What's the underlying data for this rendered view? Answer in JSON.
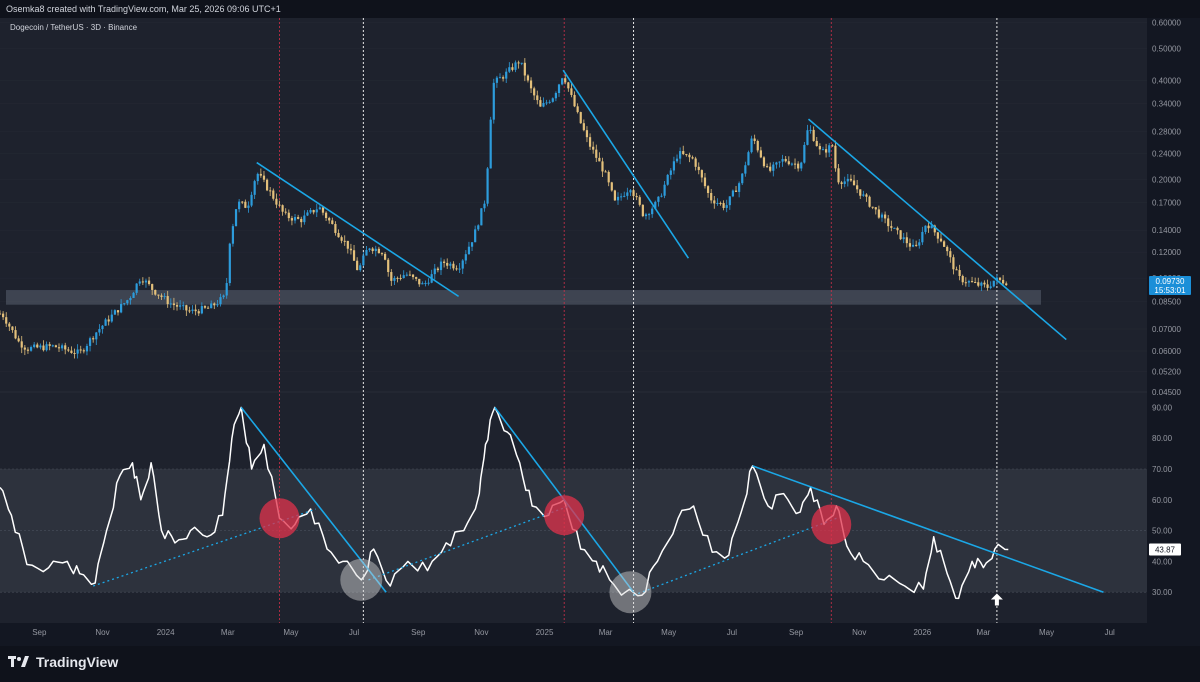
{
  "header": {
    "attribution": "Osemka8 created with TradingView.com, Mar 25, 2026 09:06 UTC+1",
    "symbol": "Dogecoin / TetherUS · 3D · Binance"
  },
  "price_badge": {
    "price": "0.09730",
    "countdown": "15:53:01"
  },
  "rsi_badge": "43.87",
  "footer": {
    "brand": "TradingView"
  },
  "colors": {
    "background": "#131722",
    "up": "#2d9cdb",
    "down": "#e3c07b",
    "trendline": "#1ba7e6",
    "rsi_line": "#ffffff",
    "zone": "#5a6170",
    "red_marker": "#e0314b",
    "price_badge": "#1b8fd8"
  },
  "chart_data": [
    {
      "type": "candlestick",
      "title": "Dogecoin / TetherUS · 3D · Binance",
      "scale": "log",
      "y_ticks": [
        "0.60000",
        "0.50000",
        "0.40000",
        "0.34000",
        "0.28000",
        "0.24000",
        "0.20000",
        "0.17000",
        "0.14000",
        "0.12000",
        "0.10000",
        "0.08500",
        "0.07000",
        "0.06000",
        "0.05200",
        "0.04500"
      ],
      "x_ticks": [
        "Sep",
        "Nov",
        "2024",
        "Mar",
        "May",
        "Jul",
        "Sep",
        "Nov",
        "2025",
        "Mar",
        "May",
        "Jul",
        "Sep",
        "Nov",
        "2026",
        "Mar",
        "May",
        "Jul"
      ],
      "xlim": [
        "2023-07-25",
        "2026-08-06"
      ],
      "ylim": [
        0.045,
        0.62
      ],
      "close_series": [
        [
          "2023-07-27",
          0.078
        ],
        [
          "2023-08-12",
          0.064
        ],
        [
          "2023-08-20",
          0.061
        ],
        [
          "2023-09-15",
          0.062
        ],
        [
          "2023-10-10",
          0.059
        ],
        [
          "2023-10-25",
          0.068
        ],
        [
          "2023-11-12",
          0.078
        ],
        [
          "2023-11-27",
          0.087
        ],
        [
          "2023-12-08",
          0.101
        ],
        [
          "2023-12-20",
          0.092
        ],
        [
          "2024-01-05",
          0.084
        ],
        [
          "2024-01-25",
          0.079
        ],
        [
          "2024-02-12",
          0.081
        ],
        [
          "2024-02-28",
          0.088
        ],
        [
          "2024-03-03",
          0.13
        ],
        [
          "2024-03-10",
          0.17
        ],
        [
          "2024-03-20",
          0.165
        ],
        [
          "2024-03-29",
          0.21
        ],
        [
          "2024-04-10",
          0.185
        ],
        [
          "2024-04-25",
          0.155
        ],
        [
          "2024-05-10",
          0.15
        ],
        [
          "2024-05-28",
          0.165
        ],
        [
          "2024-06-10",
          0.145
        ],
        [
          "2024-06-25",
          0.125
        ],
        [
          "2024-07-05",
          0.105
        ],
        [
          "2024-07-15",
          0.125
        ],
        [
          "2024-07-30",
          0.12
        ],
        [
          "2024-08-05",
          0.098
        ],
        [
          "2024-08-20",
          0.103
        ],
        [
          "2024-09-06",
          0.095
        ],
        [
          "2024-09-25",
          0.112
        ],
        [
          "2024-10-10",
          0.108
        ],
        [
          "2024-10-25",
          0.135
        ],
        [
          "2024-11-05",
          0.175
        ],
        [
          "2024-11-12",
          0.39
        ],
        [
          "2024-11-25",
          0.42
        ],
        [
          "2024-12-08",
          0.46
        ],
        [
          "2024-12-18",
          0.38
        ],
        [
          "2024-12-28",
          0.33
        ],
        [
          "2025-01-10",
          0.36
        ],
        [
          "2025-01-19",
          0.42
        ],
        [
          "2025-02-01",
          0.32
        ],
        [
          "2025-02-12",
          0.26
        ],
        [
          "2025-02-28",
          0.21
        ],
        [
          "2025-03-10",
          0.17
        ],
        [
          "2025-03-25",
          0.19
        ],
        [
          "2025-04-07",
          0.155
        ],
        [
          "2025-04-20",
          0.17
        ],
        [
          "2025-05-10",
          0.24
        ],
        [
          "2025-05-25",
          0.23
        ],
        [
          "2025-06-10",
          0.175
        ],
        [
          "2025-06-25",
          0.165
        ],
        [
          "2025-07-10",
          0.2
        ],
        [
          "2025-07-21",
          0.27
        ],
        [
          "2025-08-05",
          0.21
        ],
        [
          "2025-08-20",
          0.23
        ],
        [
          "2025-09-05",
          0.22
        ],
        [
          "2025-09-13",
          0.29
        ],
        [
          "2025-09-25",
          0.24
        ],
        [
          "2025-10-07",
          0.255
        ],
        [
          "2025-10-10",
          0.2
        ],
        [
          "2025-10-25",
          0.195
        ],
        [
          "2025-11-10",
          0.17
        ],
        [
          "2025-11-25",
          0.15
        ],
        [
          "2025-12-10",
          0.135
        ],
        [
          "2025-12-25",
          0.122
        ],
        [
          "2026-01-05",
          0.148
        ],
        [
          "2026-01-20",
          0.13
        ],
        [
          "2026-02-05",
          0.1
        ],
        [
          "2026-02-20",
          0.096
        ],
        [
          "2026-03-05",
          0.094
        ],
        [
          "2026-03-12",
          0.099
        ],
        [
          "2026-03-25",
          0.0973
        ]
      ],
      "support_zone": [
        0.083,
        0.092
      ],
      "trendlines": [
        [
          [
            "2024-03-29",
            0.225
          ],
          [
            "2024-10-10",
            0.088
          ]
        ],
        [
          [
            "2025-01-19",
            0.43
          ],
          [
            "2025-05-20",
            0.115
          ]
        ],
        [
          [
            "2025-09-13",
            0.305
          ],
          [
            "2026-05-20",
            0.065
          ]
        ]
      ]
    },
    {
      "type": "line",
      "y_ticks": [
        "90.00",
        "80.00",
        "70.00",
        "60.00",
        "50.00",
        "40.00",
        "30.00"
      ],
      "x_ticks": [
        "Sep",
        "Nov",
        "2024",
        "Mar",
        "May",
        "Jul",
        "Sep",
        "Nov",
        "2025",
        "Mar",
        "May",
        "Jul",
        "Sep",
        "Nov",
        "2026",
        "Mar",
        "May",
        "Jul"
      ],
      "ylim": [
        20,
        95
      ],
      "zone": [
        30,
        70
      ],
      "series": [
        {
          "values": [
            [
              "2023-07-25",
              64
            ],
            [
              "2023-08-05",
              55
            ],
            [
              "2023-08-20",
              39
            ],
            [
              "2023-09-10",
              38
            ],
            [
              "2023-09-28",
              40
            ],
            [
              "2023-10-10",
              36
            ],
            [
              "2023-10-25",
              33
            ],
            [
              "2023-11-05",
              50
            ],
            [
              "2023-11-18",
              68
            ],
            [
              "2023-11-30",
              72
            ],
            [
              "2023-12-08",
              60
            ],
            [
              "2023-12-18",
              72
            ],
            [
              "2023-12-28",
              50
            ],
            [
              "2024-01-10",
              46
            ],
            [
              "2024-01-25",
              50
            ],
            [
              "2024-02-10",
              48
            ],
            [
              "2024-02-25",
              55
            ],
            [
              "2024-03-05",
              80
            ],
            [
              "2024-03-14",
              90
            ],
            [
              "2024-03-24",
              70
            ],
            [
              "2024-04-05",
              78
            ],
            [
              "2024-04-20",
              54
            ],
            [
              "2024-05-05",
              52
            ],
            [
              "2024-05-20",
              57
            ],
            [
              "2024-06-05",
              44
            ],
            [
              "2024-06-20",
              40
            ],
            [
              "2024-07-08",
              34
            ],
            [
              "2024-07-20",
              44
            ],
            [
              "2024-08-05",
              32
            ],
            [
              "2024-08-22",
              40
            ],
            [
              "2024-09-10",
              37
            ],
            [
              "2024-09-28",
              46
            ],
            [
              "2024-10-15",
              50
            ],
            [
              "2024-10-30",
              62
            ],
            [
              "2024-11-05",
              78
            ],
            [
              "2024-11-14",
              90
            ],
            [
              "2024-11-26",
              82
            ],
            [
              "2024-12-08",
              72
            ],
            [
              "2024-12-20",
              58
            ],
            [
              "2025-01-05",
              55
            ],
            [
              "2025-01-20",
              60
            ],
            [
              "2025-02-05",
              44
            ],
            [
              "2025-02-20",
              40
            ],
            [
              "2025-03-05",
              34
            ],
            [
              "2025-03-20",
              30
            ],
            [
              "2025-04-05",
              29
            ],
            [
              "2025-04-20",
              40
            ],
            [
              "2025-05-10",
              54
            ],
            [
              "2025-05-25",
              58
            ],
            [
              "2025-06-12",
              43
            ],
            [
              "2025-06-28",
              42
            ],
            [
              "2025-07-10",
              56
            ],
            [
              "2025-07-21",
              71
            ],
            [
              "2025-08-05",
              58
            ],
            [
              "2025-08-20",
              62
            ],
            [
              "2025-09-05",
              56
            ],
            [
              "2025-09-15",
              64
            ],
            [
              "2025-09-28",
              52
            ],
            [
              "2025-10-10",
              58
            ],
            [
              "2025-10-20",
              45
            ],
            [
              "2025-11-05",
              40
            ],
            [
              "2025-11-25",
              34
            ],
            [
              "2025-12-15",
              32
            ],
            [
              "2026-01-02",
              31
            ],
            [
              "2026-01-12",
              48
            ],
            [
              "2026-01-25",
              36
            ],
            [
              "2026-02-05",
              28
            ],
            [
              "2026-02-18",
              40
            ],
            [
              "2026-03-01",
              38
            ],
            [
              "2026-03-12",
              44
            ],
            [
              "2026-03-25",
              43.87
            ]
          ]
        }
      ],
      "trendlines": [
        [
          [
            "2024-03-14",
            90
          ],
          [
            "2024-08-01",
            30
          ]
        ],
        [
          [
            "2024-11-14",
            90
          ],
          [
            "2025-03-28",
            30
          ]
        ],
        [
          [
            "2025-07-21",
            71
          ],
          [
            "2026-06-25",
            30
          ]
        ]
      ],
      "dotted_trendlines": [
        [
          [
            "2023-10-23",
            32
          ],
          [
            "2024-05-25",
            57
          ]
        ],
        [
          [
            "2024-07-15",
            34
          ],
          [
            "2025-01-25",
            58
          ]
        ],
        [
          [
            "2025-03-28",
            29
          ],
          [
            "2025-10-10",
            54
          ]
        ]
      ],
      "red_markers": [
        [
          "2024-04-20",
          54
        ],
        [
          "2025-01-20",
          55
        ],
        [
          "2025-10-05",
          52
        ]
      ],
      "grey_markers": [
        [
          "2024-07-08",
          34
        ],
        [
          "2025-03-25",
          30
        ]
      ]
    }
  ],
  "vertical_markers": {
    "red": [
      "2024-04-20",
      "2025-01-20",
      "2025-10-05"
    ],
    "white": [
      "2024-07-10",
      "2025-03-28",
      "2026-03-14"
    ]
  }
}
